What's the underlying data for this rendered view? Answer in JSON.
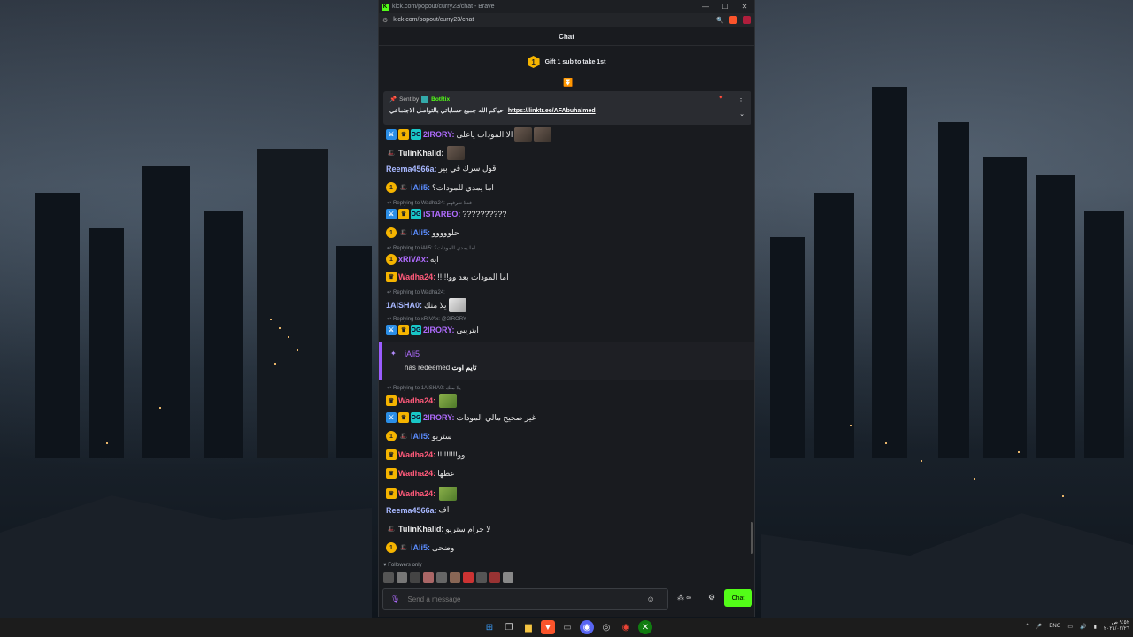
{
  "window": {
    "title": "kick.com/popout/curry23/chat - Brave",
    "url": "kick.com/popout/curry23/chat",
    "notifications_count": "1"
  },
  "chat": {
    "header": "Chat",
    "gift_rank": "1",
    "gift_text": "Gift 1 sub to take 1st"
  },
  "pinned": {
    "sent_by_label": "Sent by",
    "bot_name": "BotRix",
    "message": "حياكم الله جميع حساباتي بالتواصل الاجتماعي",
    "link": "https://linktr.ee/AFAbuhalmed"
  },
  "messages": [
    {
      "user": "2IRORY:",
      "text": "الا المودات ياعلى"
    },
    {
      "user": "TulinKhalid:",
      "text": ""
    },
    {
      "user": "Reema4566a:",
      "text": "قول سرك في بير"
    },
    {
      "user": "iAli5:",
      "text": "اما يمدي للمودات؟"
    },
    {
      "reply": "Replying to Wadha24: فعلا تعرفهم",
      "user": "iSTAREO:",
      "text": "??????????"
    },
    {
      "user": "iAli5:",
      "text": "حلووووو"
    },
    {
      "reply": "Replying to iAli5: اما يمدي للمودات؟",
      "user": "xRIVAx:",
      "text": "ايه"
    },
    {
      "user": "Wadha24:",
      "text": "اما المودات بعد وو!!!!!"
    },
    {
      "reply": "Replying to Wadha24:",
      "user": "1AISHA0:",
      "text": "يلا منك"
    },
    {
      "reply": "Replying to xRIVAx: @2IRORY",
      "user": "2IRORY:",
      "text": "ابتريبي"
    },
    {
      "reply": "Replying to 1AISHA0: يلا منك",
      "user": "Wadha24:",
      "text": ""
    },
    {
      "user": "2IRORY:",
      "text": "غير صحيح مالي المودات"
    },
    {
      "user": "iAli5:",
      "text": "ستريو"
    },
    {
      "user": "Wadha24:",
      "text": "وو!!!!!!!!!"
    },
    {
      "user": "Wadha24:",
      "text": "عطها"
    },
    {
      "user": "Wadha24:",
      "text": ""
    },
    {
      "user": "Reema4566a:",
      "text": "اف"
    },
    {
      "user": "TulinKhalid:",
      "text": "لا حرام ستريو"
    },
    {
      "user": "iAli5:",
      "text": "وضحى"
    }
  ],
  "redeem": {
    "user": "iAli5",
    "action": "has redeemed",
    "reward": "تايم اوت"
  },
  "footer": {
    "followers_only": "Followers only",
    "input_placeholder": "Send a message",
    "points": "∞",
    "chat_button": "Chat"
  },
  "tray": {
    "lang": "ENG",
    "time": "٩:٥٢ ص",
    "date": "٢٠٢٤/٠٢/٢٦"
  },
  "colors": {
    "kick_green": "#53fc18",
    "accent_purple": "#9b5cff"
  }
}
